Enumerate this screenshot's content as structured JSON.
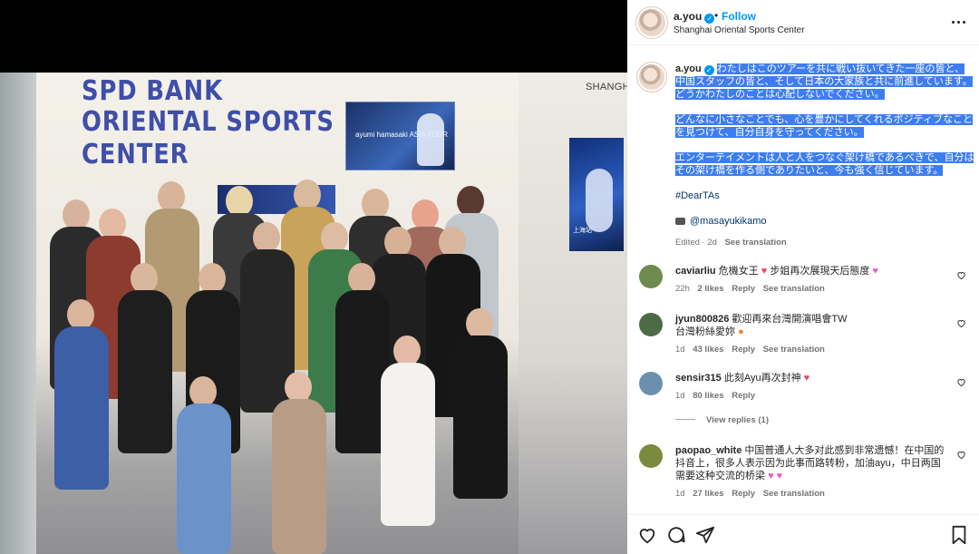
{
  "photo": {
    "venue_sign_lines": [
      "SPD BANK",
      "ORIENTAL SPORTS",
      "CENTER"
    ],
    "corner_sign": "SHANGHA",
    "poster_text": "ayumi hamasaki ASIA TOUR",
    "poster_side_text": "上海站"
  },
  "header": {
    "username": "a.you",
    "verified_mark": "✓",
    "separator": "•",
    "follow_label": "Follow",
    "location": "Shanghai Oriental Sports Center"
  },
  "caption": {
    "username": "a.you",
    "paragraphs": [
      "わたしはこのツアーを共に戦い抜いてきた一座の皆と、中国スタッフの皆と、そして日本の大家族と共に前進しています。どうかわたしのことは心配しないでください。",
      "どんなに小さなことでも、心を豊かにしてくれるポジティブなことを見つけて、自分自身を守ってください。",
      "エンターテイメントは人と人をつなぐ架け橋であるべきで、自分はその架け橋を作る側でありたいと、今も強く信じています。"
    ],
    "hashtag": "#DearTAs",
    "mention": "@masayukikamo",
    "edited": "Edited · 2d",
    "see_translation": "See translation"
  },
  "comments": [
    {
      "username": "caviarliu",
      "text_before": "危機女王",
      "text_after": "步姐再次展現天后態度",
      "time": "22h",
      "likes": "2 likes",
      "reply": "Reply",
      "see_translation": "See translation",
      "avatar_color": "#6f8a4d"
    },
    {
      "username": "jyun800826",
      "text_line1": "歡迎再來台灣開演唱會TW",
      "text_line2": "台灣粉絲愛妳",
      "time": "1d",
      "likes": "43 likes",
      "reply": "Reply",
      "see_translation": "See translation",
      "avatar_color": "#4d6a47"
    },
    {
      "username": "sensir315",
      "text": "此刻Ayu再次封神",
      "time": "1d",
      "likes": "80 likes",
      "reply": "Reply",
      "view_replies": "View replies (1)",
      "avatar_color": "#6b8fae"
    },
    {
      "username": "paopao_white",
      "text": "中国普通人大多对此感到非常遗憾！在中国的抖音上，很多人表示因为此事而路转粉，加油ayu，中日两国需要这种交流的桥梁",
      "time": "1d",
      "likes": "27 likes",
      "reply": "Reply",
      "see_translation": "See translation",
      "avatar_color": "#7a8b3f"
    }
  ],
  "icons": {
    "heart": "heart-icon",
    "comment": "comment-icon",
    "share": "share-icon",
    "save": "bookmark-icon",
    "more": "more-options-icon"
  },
  "colors": {
    "accent": "#0095f6",
    "highlight": "#3d7df0",
    "like_red": "#ed4956"
  }
}
